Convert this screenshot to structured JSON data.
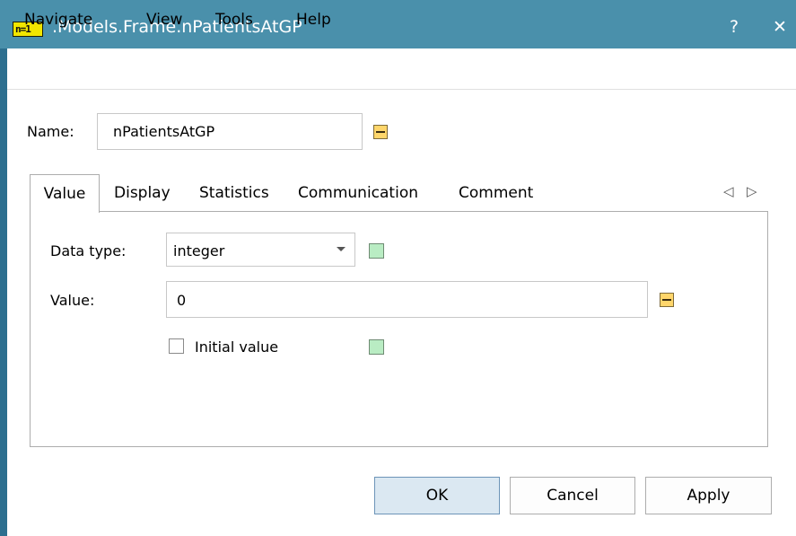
{
  "window": {
    "title": ".Models.Frame.nPatientsAtGP",
    "app_icon_text": "n=1",
    "help_button": "?",
    "close_button": "✕"
  },
  "menu": {
    "items": [
      {
        "label": "Navigate"
      },
      {
        "label": "View"
      },
      {
        "label": "Tools"
      },
      {
        "label": "Help"
      }
    ]
  },
  "name_field": {
    "label": "Name:",
    "value": "nPatientsAtGP"
  },
  "tabs": {
    "items": [
      {
        "label": "Value",
        "active": true
      },
      {
        "label": "Display"
      },
      {
        "label": "Statistics"
      },
      {
        "label": "Communication"
      },
      {
        "label": "Comment"
      }
    ],
    "scroll_left": "◁",
    "scroll_right": "▷"
  },
  "value_tab": {
    "data_type_label": "Data type:",
    "data_type_value": "integer",
    "value_label": "Value:",
    "value_value": "0",
    "initial_value_label": "Initial value",
    "initial_value_checked": false
  },
  "buttons": {
    "ok": "OK",
    "cancel": "Cancel",
    "apply": "Apply"
  },
  "colors": {
    "titlebar": "#4a90ab",
    "edit_icon": "#ffd66b",
    "link_icon": "#b9ecc3",
    "default_button": "#dbe8f2"
  }
}
